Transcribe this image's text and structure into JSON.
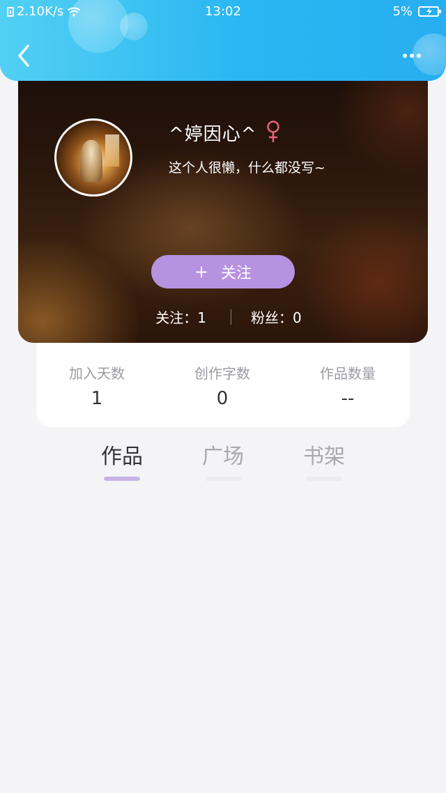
{
  "status_bar": {
    "network_speed": "2.10K/s",
    "time": "13:02",
    "battery_percent": "5%",
    "icons": [
      "sim-icon",
      "wifi-icon",
      "battery-charging-icon"
    ]
  },
  "header": {
    "back_icon": "chevron-left-icon",
    "more_icon": "more-dots-icon",
    "colors": {
      "gradient_start": "#52d0f3",
      "gradient_end": "#27aef0"
    }
  },
  "profile": {
    "username": "^婷因心^",
    "gender_icon": "female-icon",
    "gender_color": "#e9637b",
    "bio": "这个人很懒，什么都没写~",
    "follow_button": {
      "plus": "+",
      "label": "关注",
      "color": "#b792e0"
    },
    "following_text": "关注：1",
    "followers_text": "粉丝：0"
  },
  "stats": [
    {
      "label": "加入天数",
      "value": "1"
    },
    {
      "label": "创作字数",
      "value": "0"
    },
    {
      "label": "作品数量",
      "value": "--"
    }
  ],
  "tabs": [
    {
      "label": "作品",
      "active": true
    },
    {
      "label": "广场",
      "active": false
    },
    {
      "label": "书架",
      "active": false
    }
  ],
  "accent_color": "#c7b2e6"
}
